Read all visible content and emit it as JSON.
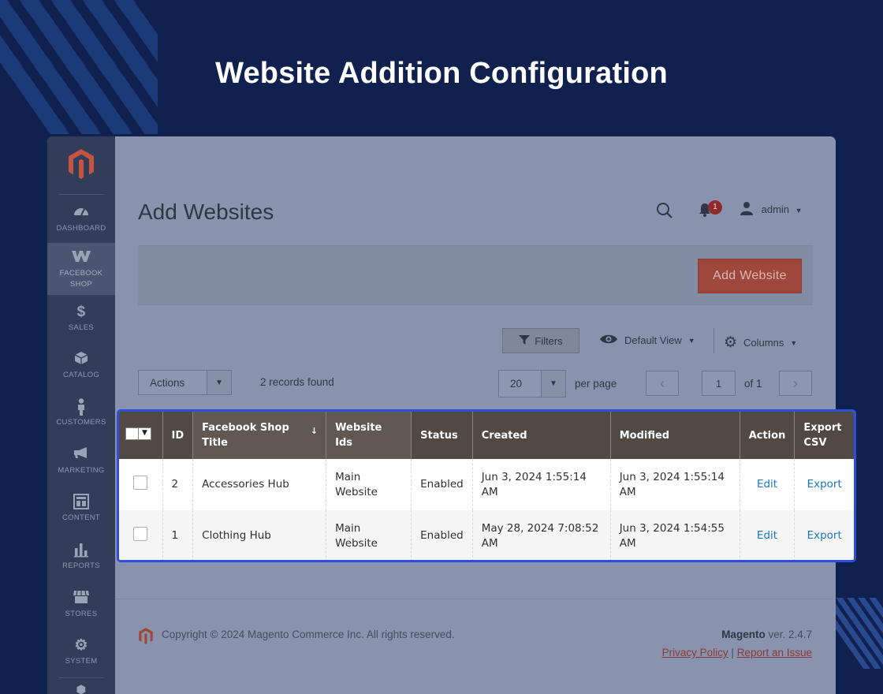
{
  "banner": {
    "title": "Website Addition Configuration"
  },
  "sidebar": {
    "items": [
      {
        "label": "DASHBOARD",
        "icon": "dashboard-icon"
      },
      {
        "label": "FACEBOOK SHOP",
        "icon": "facebook-shop-icon",
        "active": true
      },
      {
        "label": "SALES",
        "icon": "dollar-icon"
      },
      {
        "label": "CATALOG",
        "icon": "box-icon"
      },
      {
        "label": "CUSTOMERS",
        "icon": "person-icon"
      },
      {
        "label": "MARKETING",
        "icon": "megaphone-icon"
      },
      {
        "label": "CONTENT",
        "icon": "layout-icon"
      },
      {
        "label": "REPORTS",
        "icon": "bar-chart-icon"
      },
      {
        "label": "STORES",
        "icon": "store-icon"
      },
      {
        "label": "SYSTEM",
        "icon": "gear-icon"
      }
    ]
  },
  "header": {
    "page_title": "Add Websites",
    "notification_count": "1",
    "user": "admin"
  },
  "actionbar": {
    "add_label": "Add Website"
  },
  "toolbar": {
    "filters_label": "Filters",
    "view_label": "Default View",
    "columns_label": "Columns",
    "actions_label": "Actions",
    "records_found": "2 records found",
    "per_page_value": "20",
    "per_page_label": "per page",
    "page_value": "1",
    "page_of": "of 1"
  },
  "grid": {
    "columns": [
      "ID",
      "Facebook Shop Title",
      "Website Ids",
      "Status",
      "Created",
      "Modified",
      "Action",
      "Export CSV"
    ],
    "sort_indicator": "↓",
    "rows": [
      {
        "id": "2",
        "title": "Accessories Hub",
        "website_ids": "Main Website",
        "status": "Enabled",
        "created": "Jun 3, 2024 1:55:14 AM",
        "modified": "Jun 3, 2024 1:55:14 AM",
        "action": "Edit",
        "export": "Export"
      },
      {
        "id": "1",
        "title": "Clothing Hub",
        "website_ids": "Main Website",
        "status": "Enabled",
        "created": "May 28, 2024 7:08:52 AM",
        "modified": "Jun 3, 2024 1:54:55 AM",
        "action": "Edit",
        "export": "Export"
      }
    ]
  },
  "footer": {
    "copyright": "Copyright © 2024 Magento Commerce Inc. All rights reserved.",
    "brand": "Magento",
    "version": "ver. 2.4.7",
    "privacy": "Privacy Policy",
    "separator": "|",
    "report": "Report an Issue"
  },
  "colors": {
    "background": "#10214f",
    "grid_header": "#514943",
    "highlight_border": "#2f4fd6",
    "link": "#1979c3",
    "add_button": "#a0473d"
  }
}
